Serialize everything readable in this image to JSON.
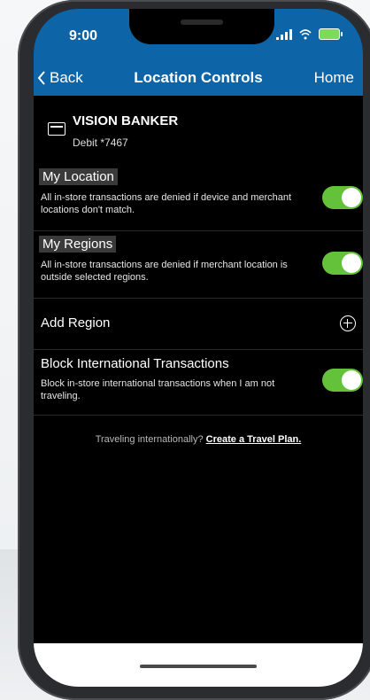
{
  "status": {
    "time": "9:00"
  },
  "nav": {
    "back_label": "Back",
    "title": "Location Controls",
    "home_label": "Home"
  },
  "card": {
    "name": "VISION BANKER",
    "sub": "Debit *7467"
  },
  "settings": [
    {
      "title": "My Location",
      "desc": "All in-store transactions are denied if device and merchant locations don't match.",
      "toggle_on": true
    },
    {
      "title": "My Regions",
      "desc": "All in-store transactions are denied if merchant location is outside selected regions.",
      "toggle_on": true
    },
    {
      "title": "Add Region"
    },
    {
      "title": "Block International Transactions",
      "desc": "Block in-store international transactions when I am not traveling.",
      "toggle_on": true
    }
  ],
  "travel": {
    "prompt": "Traveling internationally?",
    "link": "Create a Travel Plan."
  },
  "colors": {
    "nav_blue": "#0d64a6",
    "toggle_green": "#63c23a"
  }
}
